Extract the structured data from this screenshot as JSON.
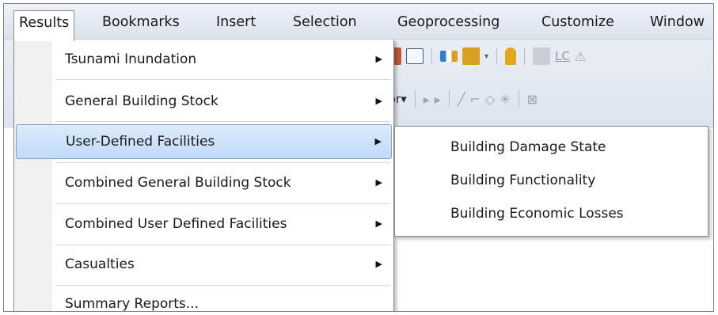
{
  "menubar": {
    "items": [
      {
        "label": "Results",
        "open": true
      },
      {
        "label": "Bookmarks"
      },
      {
        "label": "Insert"
      },
      {
        "label": "Selection"
      },
      {
        "label": "Geoprocessing"
      },
      {
        "label": "Customize"
      },
      {
        "label": "Window"
      }
    ]
  },
  "toolbar": {
    "lc_label": "LC",
    "editor_label": "tor▾"
  },
  "results_menu": {
    "items": [
      {
        "label": "Tsunami Inundation",
        "has_submenu": true
      },
      {
        "label": "General Building Stock",
        "has_submenu": true
      },
      {
        "label": "User-Defined Facilities",
        "has_submenu": true,
        "highlighted": true
      },
      {
        "label": "Combined General Building Stock",
        "has_submenu": true
      },
      {
        "label": "Combined User Defined Facilities",
        "has_submenu": true
      },
      {
        "label": "Casualties",
        "has_submenu": true
      },
      {
        "label": "Summary Reports...",
        "has_submenu": false
      }
    ],
    "arrow_glyph": "▶"
  },
  "submenu": {
    "items": [
      {
        "label": "Building Damage State"
      },
      {
        "label": "Building Functionality"
      },
      {
        "label": "Building Economic Losses"
      }
    ]
  },
  "colors": {
    "highlight_top": "#dcebfc",
    "highlight_bottom": "#c1dbfa",
    "highlight_border": "#7da2ce",
    "menubar_bg": "#dbe3ee"
  }
}
